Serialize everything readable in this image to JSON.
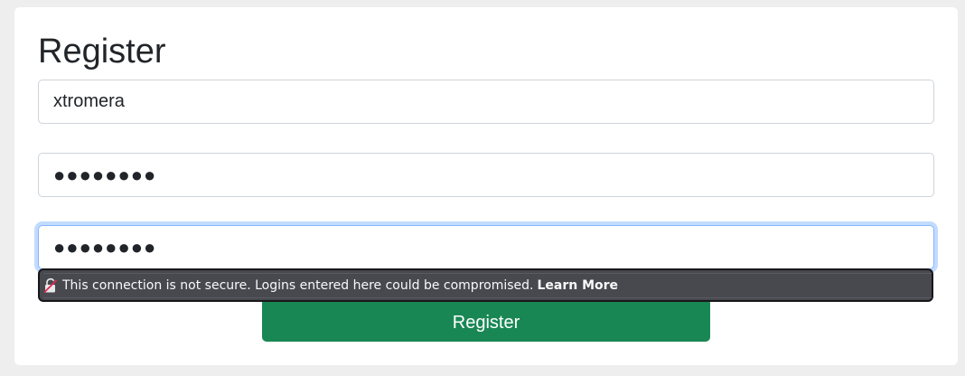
{
  "form": {
    "title": "Register",
    "username_value": "xtromera",
    "password_value": "●●●●●●●●",
    "confirm_value": "●●●●●●●●",
    "submit_label": "Register"
  },
  "insecure_warning": {
    "message": "This connection is not secure. Logins entered here could be compromised.",
    "link_label": "Learn More",
    "icon": "insecure-lock-icon"
  },
  "colors": {
    "submit_bg": "#198754",
    "focus_ring": "#86b7fe",
    "warning_bg": "#48494f"
  }
}
